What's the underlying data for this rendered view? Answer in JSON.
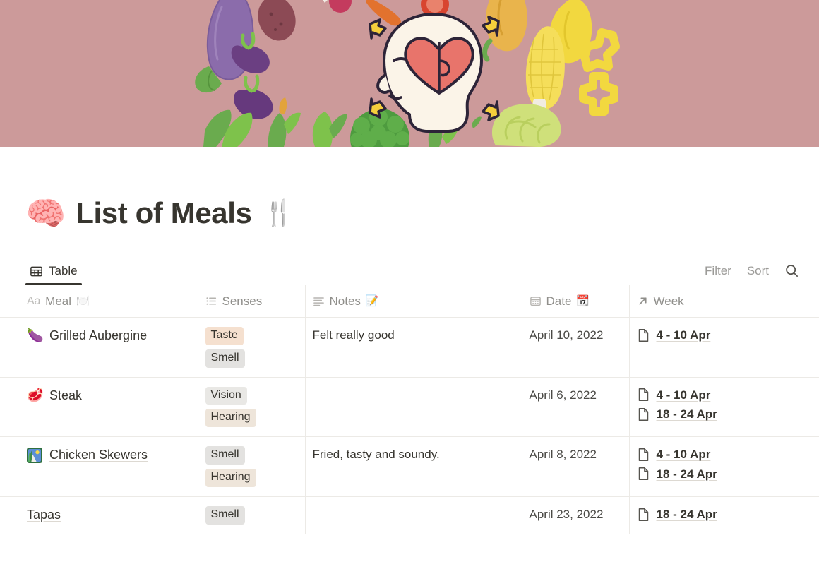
{
  "cover": {
    "name": "meals-cover-illustration",
    "background_color": "#cc9a9a",
    "description": "Head profile with heart puzzle brain surrounded by vegetables"
  },
  "page": {
    "emoji": "🧠",
    "title": "List of Meals",
    "title_emoji": "🍴"
  },
  "toolbar": {
    "tabs": [
      {
        "label": "Table",
        "icon": "table-icon",
        "active": true
      }
    ],
    "filter_label": "Filter",
    "sort_label": "Sort",
    "search_icon": "search-icon"
  },
  "table": {
    "columns": [
      {
        "key": "meal",
        "type_badge": "Aa",
        "label": "Meal",
        "emoji": "🍽️",
        "icon": "text-property-icon"
      },
      {
        "key": "senses",
        "label": "Senses",
        "emoji": "",
        "icon": "multi-select-icon"
      },
      {
        "key": "notes",
        "label": "Notes",
        "emoji": "📝",
        "icon": "text-lines-icon"
      },
      {
        "key": "date",
        "label": "Date",
        "emoji": "📆",
        "icon": "calendar-icon"
      },
      {
        "key": "week",
        "label": "Week",
        "emoji": "",
        "icon": "relation-arrow-icon"
      }
    ],
    "rows": [
      {
        "emoji": "🍆",
        "emoji_kind": "emoji",
        "meal": "Grilled Aubergine",
        "senses": [
          {
            "label": "Taste",
            "color_class": "taste",
            "color": "#f5e0cf"
          },
          {
            "label": "Smell",
            "color_class": "smell",
            "color": "#e3e2e0"
          }
        ],
        "notes": "Felt really good",
        "date": "April 10, 2022",
        "weeks": [
          "4 - 10 Apr"
        ]
      },
      {
        "emoji": "🥩",
        "emoji_kind": "emoji",
        "meal": "Steak",
        "senses": [
          {
            "label": "Vision",
            "color_class": "vision",
            "color": "#e9e8e5"
          },
          {
            "label": "Hearing",
            "color_class": "hearing",
            "color": "#eee5da"
          }
        ],
        "notes": "",
        "date": "April 6, 2022",
        "weeks": [
          "4 - 10 Apr",
          "18 - 24 Apr"
        ]
      },
      {
        "emoji": "🖼️",
        "emoji_kind": "image-placeholder",
        "meal": "Chicken Skewers",
        "senses": [
          {
            "label": "Smell",
            "color_class": "smell",
            "color": "#e3e2e0"
          },
          {
            "label": "Hearing",
            "color_class": "hearing",
            "color": "#eee5da"
          }
        ],
        "notes": "Fried, tasty and soundy.",
        "date": "April 8, 2022",
        "weeks": [
          "4 - 10 Apr",
          "18 - 24 Apr"
        ]
      },
      {
        "emoji": "",
        "emoji_kind": "none",
        "meal": "Tapas",
        "senses": [
          {
            "label": "Smell",
            "color_class": "smell",
            "color": "#e3e2e0"
          }
        ],
        "notes": "",
        "date": "April 23, 2022",
        "weeks": [
          "18 - 24 Apr"
        ]
      }
    ]
  }
}
